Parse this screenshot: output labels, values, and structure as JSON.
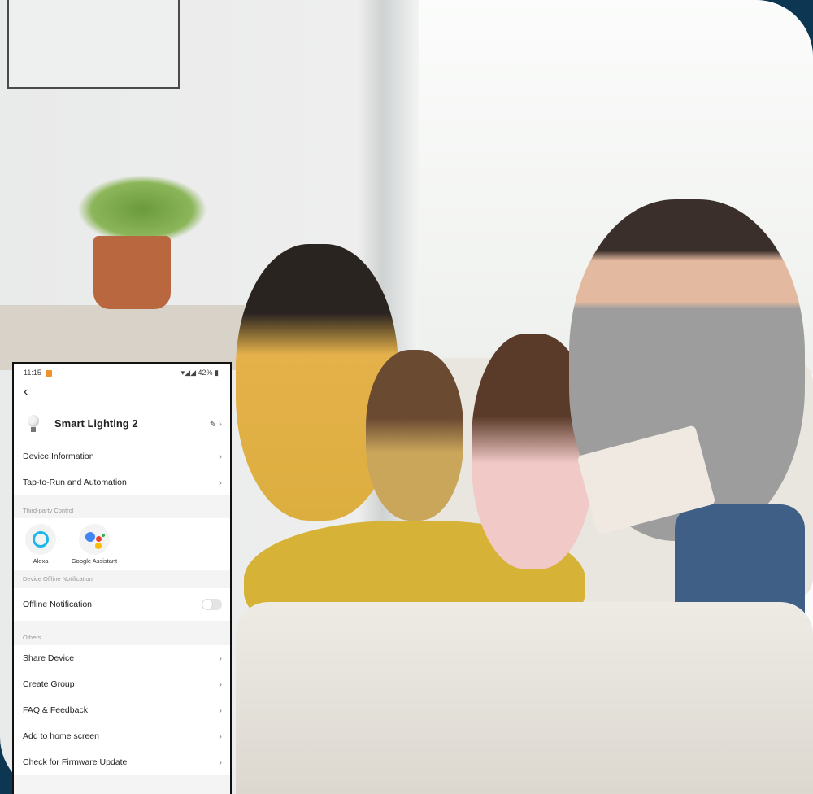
{
  "status_bar": {
    "time": "11:15",
    "battery": "42%"
  },
  "device": {
    "name": "Smart Lighting 2"
  },
  "menu_top": [
    {
      "label": "Device Information"
    },
    {
      "label": "Tap-to-Run and Automation"
    }
  ],
  "third_party": {
    "header": "Third-party Control",
    "items": [
      {
        "label": "Alexa"
      },
      {
        "label": "Google Assistant"
      }
    ]
  },
  "offline": {
    "header": "Device Offline Notification",
    "label": "Offline Notification",
    "enabled": false
  },
  "others": {
    "header": "Others",
    "items": [
      {
        "label": "Share Device"
      },
      {
        "label": "Create Group"
      },
      {
        "label": "FAQ & Feedback"
      },
      {
        "label": "Add to home screen"
      },
      {
        "label": "Check for Firmware Update"
      }
    ]
  },
  "colors": {
    "frame": "#0c3651",
    "alexa": "#1fb6e8"
  }
}
